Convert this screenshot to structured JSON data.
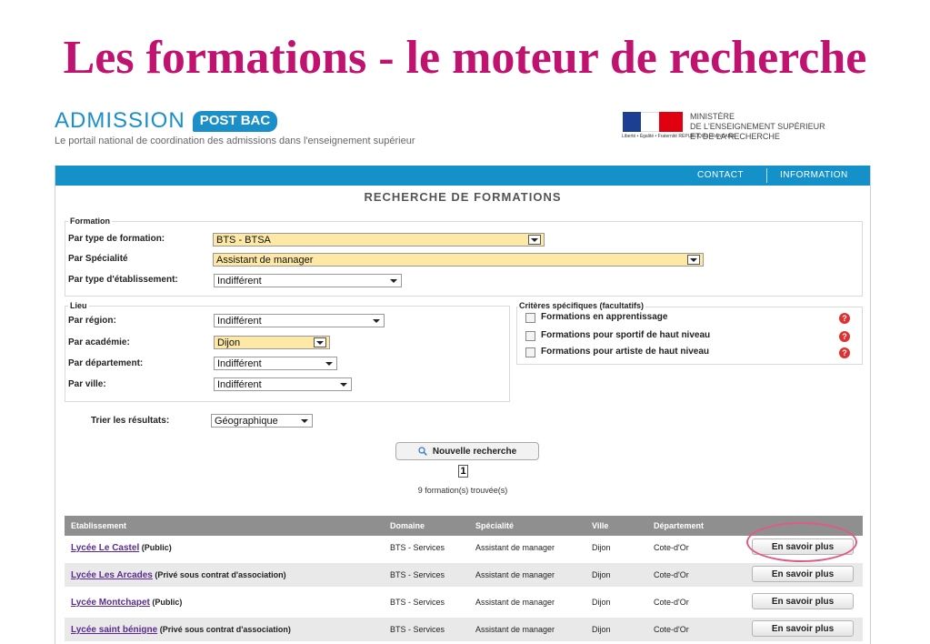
{
  "slide_title": "Les formations - le moteur de recherche",
  "header": {
    "logo_word": "ADMISSION",
    "logo_badge": "POST BAC",
    "tagline": "Le portail national de coordination des admissions dans l'enseignement supérieur",
    "ministry_motto": "Liberté • Égalité • Fraternité RÉPUBLIQUE FRANÇAISE",
    "ministry_lines": [
      "MINISTÈRE",
      "DE L'ENSEIGNEMENT SUPÉRIEUR",
      "ET DE LA RECHERCHE"
    ]
  },
  "nav": {
    "contact": "CONTACT",
    "information": "INFORMATION"
  },
  "page_heading": "RECHERCHE DE FORMATIONS",
  "formation": {
    "legend": "Formation",
    "type_label": "Par type de formation:",
    "type_value": "BTS - BTSA",
    "specialite_label": "Par Spécialité",
    "specialite_value": "Assistant de manager",
    "etab_label": "Par type d'établissement:",
    "etab_value": "Indifférent"
  },
  "lieu": {
    "legend": "Lieu",
    "region_label": "Par région:",
    "region_value": "Indifférent",
    "academie_label": "Par académie:",
    "academie_value": "Dijon",
    "departement_label": "Par département:",
    "departement_value": "Indifférent",
    "ville_label": "Par ville:",
    "ville_value": "Indifférent"
  },
  "criteres": {
    "legend": "Critères spécifiques (facultatifs)",
    "options": [
      "Formations en apprentissage",
      "Formations pour sportif de haut niveau",
      "Formations pour artiste de haut niveau"
    ],
    "help_glyph": "?"
  },
  "sort": {
    "label": "Trier les résultats:",
    "value": "Géographique"
  },
  "search_button": "Nouvelle recherche",
  "pagination": {
    "current": "1"
  },
  "results_count": "9 formation(s) trouvée(s)",
  "table": {
    "headers": [
      "Etablissement",
      "Domaine",
      "Spécialité",
      "Ville",
      "Département"
    ],
    "action_label": "En savoir plus",
    "rows": [
      {
        "name": "Lycée Le Castel",
        "status": "(Public)",
        "domaine": "BTS - Services",
        "specialite": "Assistant de manager",
        "ville": "Dijon",
        "departement": "Cote-d'Or"
      },
      {
        "name": "Lycée Les Arcades",
        "status": "(Privé sous contrat d'association)",
        "domaine": "BTS - Services",
        "specialite": "Assistant de manager",
        "ville": "Dijon",
        "departement": "Cote-d'Or"
      },
      {
        "name": "Lycée Montchapet",
        "status": "(Public)",
        "domaine": "BTS - Services",
        "specialite": "Assistant de manager",
        "ville": "Dijon",
        "departement": "Cote-d'Or"
      },
      {
        "name": "Lycée saint bénigne",
        "status": "(Privé sous contrat d'association)",
        "domaine": "BTS - Services",
        "specialite": "Assistant de manager",
        "ville": "Dijon",
        "departement": "Cote-d'Or"
      }
    ]
  },
  "colors": {
    "title": "#c0126f",
    "brand_blue": "#1591c9",
    "highlight": "#fde8a6",
    "link": "#5b2b91"
  }
}
